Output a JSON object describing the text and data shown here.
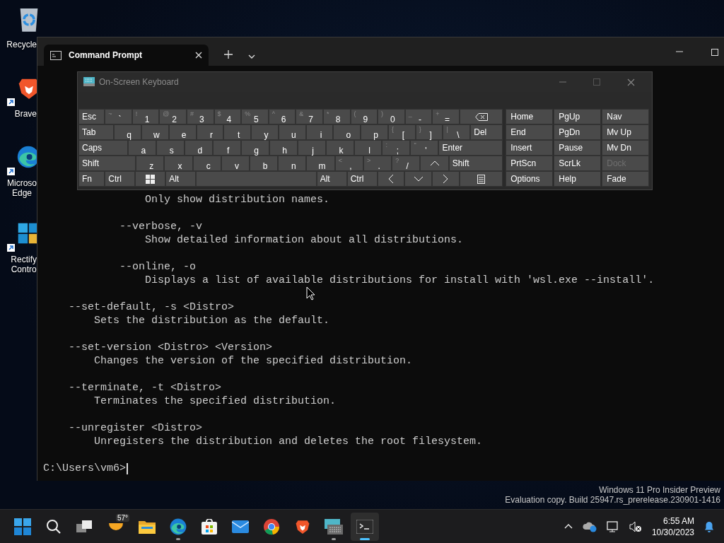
{
  "desktop_icons": [
    {
      "kind": "recycle-bin",
      "label": "Recycle",
      "shortcut": false
    },
    {
      "kind": "brave",
      "label": "Brave",
      "shortcut": true
    },
    {
      "kind": "edge",
      "label": "Microso Edge",
      "shortcut": true
    },
    {
      "kind": "rectify",
      "label": "Rectify Contro",
      "shortcut": true
    }
  ],
  "window": {
    "tab": {
      "title": "Command Prompt",
      "selected": true
    },
    "terminal": {
      "lines": [
        {
          "kind": "sub-description",
          "text": "Only show distribution names."
        },
        {
          "kind": "sub-option",
          "text": "--verbose, -v"
        },
        {
          "kind": "sub-description",
          "text": "Show detailed information about all distributions."
        },
        {
          "kind": "sub-option",
          "text": "--online, -o"
        },
        {
          "kind": "sub-description",
          "text": "Displays a list of available distributions for install with 'wsl.exe --install'."
        },
        {
          "kind": "option",
          "text": "--set-default, -s <Distro>"
        },
        {
          "kind": "description",
          "text": "Sets the distribution as the default."
        },
        {
          "kind": "option",
          "text": "--set-version <Distro> <Version>"
        },
        {
          "kind": "description",
          "text": "Changes the version of the specified distribution."
        },
        {
          "kind": "option",
          "text": "--terminate, -t <Distro>"
        },
        {
          "kind": "description",
          "text": "Terminates the specified distribution."
        },
        {
          "kind": "option",
          "text": "--unregister <Distro>"
        },
        {
          "kind": "description",
          "text": "Unregisters the distribution and deletes the root filesystem."
        }
      ],
      "prompt": "C:\\Users\\vm6>"
    }
  },
  "keyboard": {
    "title": "On-Screen Keyboard",
    "rows": [
      [
        {
          "kind": "esc",
          "main": "Esc"
        },
        {
          "kind": "char",
          "alt": "~",
          "main": "`"
        },
        {
          "kind": "char",
          "alt": "!",
          "main": "1"
        },
        {
          "kind": "char",
          "alt": "@",
          "main": "2"
        },
        {
          "kind": "char",
          "alt": "#",
          "main": "3"
        },
        {
          "kind": "char",
          "alt": "$",
          "main": "4"
        },
        {
          "kind": "char",
          "alt": "%",
          "main": "5"
        },
        {
          "kind": "char",
          "alt": "^",
          "main": "6"
        },
        {
          "kind": "char",
          "alt": "&",
          "main": "7"
        },
        {
          "kind": "char",
          "alt": "*",
          "main": "8"
        },
        {
          "kind": "char",
          "alt": "(",
          "main": "9"
        },
        {
          "kind": "char",
          "alt": ")",
          "main": "0"
        },
        {
          "kind": "char",
          "alt": "_",
          "main": "-"
        },
        {
          "kind": "char",
          "alt": "+",
          "main": "="
        },
        {
          "kind": "backspace"
        }
      ],
      [
        {
          "kind": "tab",
          "main": "Tab"
        },
        {
          "kind": "char",
          "main": "q"
        },
        {
          "kind": "char",
          "main": "w"
        },
        {
          "kind": "char",
          "main": "e"
        },
        {
          "kind": "char",
          "main": "r"
        },
        {
          "kind": "char",
          "main": "t"
        },
        {
          "kind": "char",
          "main": "y"
        },
        {
          "kind": "char",
          "main": "u"
        },
        {
          "kind": "char",
          "main": "i"
        },
        {
          "kind": "char",
          "main": "o"
        },
        {
          "kind": "char",
          "main": "p"
        },
        {
          "kind": "char",
          "alt": "{",
          "main": "["
        },
        {
          "kind": "char",
          "alt": "}",
          "main": "]"
        },
        {
          "kind": "char",
          "alt": "|",
          "main": "\\"
        },
        {
          "kind": "del",
          "main": "Del"
        }
      ],
      [
        {
          "kind": "caps",
          "main": "Caps"
        },
        {
          "kind": "char",
          "main": "a"
        },
        {
          "kind": "char",
          "main": "s"
        },
        {
          "kind": "char",
          "main": "d"
        },
        {
          "kind": "char",
          "main": "f"
        },
        {
          "kind": "char",
          "main": "g"
        },
        {
          "kind": "char",
          "main": "h"
        },
        {
          "kind": "char",
          "main": "j"
        },
        {
          "kind": "char",
          "main": "k"
        },
        {
          "kind": "char",
          "main": "l"
        },
        {
          "kind": "char",
          "alt": ":",
          "main": ";"
        },
        {
          "kind": "char",
          "alt": "\"",
          "main": "'"
        },
        {
          "kind": "enter",
          "main": "Enter"
        }
      ],
      [
        {
          "kind": "shift",
          "main": "Shift"
        },
        {
          "kind": "char",
          "main": "z"
        },
        {
          "kind": "char",
          "main": "x"
        },
        {
          "kind": "char",
          "main": "c"
        },
        {
          "kind": "char",
          "main": "v"
        },
        {
          "kind": "char",
          "main": "b"
        },
        {
          "kind": "char",
          "main": "n"
        },
        {
          "kind": "char",
          "main": "m"
        },
        {
          "kind": "char",
          "alt": "<",
          "main": ","
        },
        {
          "kind": "char",
          "alt": ">",
          "main": "."
        },
        {
          "kind": "char",
          "alt": "?",
          "main": "/"
        },
        {
          "kind": "up"
        },
        {
          "kind": "rshift",
          "main": "Shift"
        }
      ],
      [
        {
          "kind": "fn",
          "main": "Fn"
        },
        {
          "kind": "ctrl",
          "main": "Ctrl"
        },
        {
          "kind": "win"
        },
        {
          "kind": "alt",
          "main": "Alt"
        },
        {
          "kind": "space"
        },
        {
          "kind": "alt",
          "main": "Alt"
        },
        {
          "kind": "ctrl",
          "main": "Ctrl"
        },
        {
          "kind": "left"
        },
        {
          "kind": "down"
        },
        {
          "kind": "right"
        },
        {
          "kind": "menu"
        }
      ]
    ],
    "nav_keys": [
      {
        "label": "Home",
        "disabled": false
      },
      {
        "label": "PgUp",
        "disabled": false
      },
      {
        "label": "Nav",
        "disabled": false
      },
      {
        "label": "End",
        "disabled": false
      },
      {
        "label": "PgDn",
        "disabled": false
      },
      {
        "label": "Mv Up",
        "disabled": false
      },
      {
        "label": "Insert",
        "disabled": false
      },
      {
        "label": "Pause",
        "disabled": false
      },
      {
        "label": "Mv Dn",
        "disabled": false
      },
      {
        "label": "PrtScn",
        "disabled": false
      },
      {
        "label": "ScrLk",
        "disabled": false
      },
      {
        "label": "Dock",
        "disabled": true
      },
      {
        "label": "Options",
        "disabled": false
      },
      {
        "label": "Help",
        "disabled": false
      },
      {
        "label": "Fade",
        "disabled": false
      }
    ]
  },
  "watermark": [
    "Windows 11 Pro Insider Preview",
    "Evaluation copy. Build 25947.rs_prerelease.230901-1416"
  ],
  "taskbar": {
    "apps": [
      {
        "kind": "start",
        "running": false,
        "active": false
      },
      {
        "kind": "search",
        "running": false,
        "active": false
      },
      {
        "kind": "task-view",
        "running": false,
        "active": false
      },
      {
        "kind": "weather",
        "badge": "57°",
        "running": false,
        "active": false
      },
      {
        "kind": "folder",
        "running": false,
        "active": false
      },
      {
        "kind": "edge",
        "running": true,
        "active": false
      },
      {
        "kind": "store",
        "running": false,
        "active": false
      },
      {
        "kind": "mail",
        "running": false,
        "active": false
      },
      {
        "kind": "chrome",
        "running": false,
        "active": false
      },
      {
        "kind": "brave",
        "running": false,
        "active": false
      },
      {
        "kind": "keyboard",
        "running": true,
        "active": false
      },
      {
        "kind": "terminal",
        "running": true,
        "active": true
      }
    ],
    "time": "6:55 AM",
    "date": "10/30/2023"
  }
}
